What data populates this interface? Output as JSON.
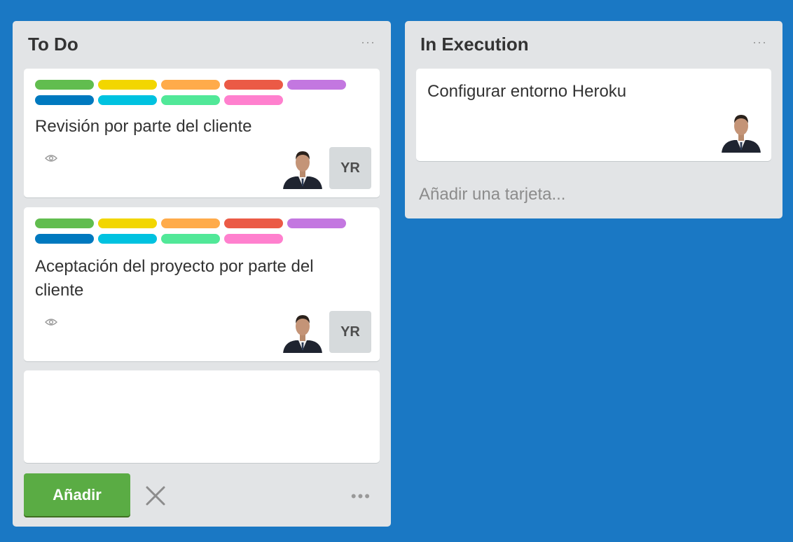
{
  "lists": [
    {
      "title": "To Do",
      "menu": "···",
      "cards": [
        {
          "title": "Revisión por parte del cliente",
          "member_initials": "YR"
        },
        {
          "title_line1": "Aceptación del proyecto por parte del",
          "title_line2": "cliente",
          "member_initials": "YR"
        }
      ],
      "composer": {
        "value": "",
        "add_label": "Añadir",
        "more": "•••"
      }
    },
    {
      "title": "In Execution",
      "menu": "···",
      "cards": [
        {
          "title": "Configurar entorno Heroku"
        }
      ],
      "add_card_label": "Añadir una tarjeta..."
    }
  ],
  "label_colors": [
    "#61bd4f",
    "#f2d600",
    "#ffab4a",
    "#eb5a46",
    "#c377e0",
    "#0079bf",
    "#00c2e0",
    "#51e898",
    "#ff80ce"
  ],
  "icons": {
    "watch": "eye-icon",
    "close": "close-icon",
    "member": "avatar"
  }
}
